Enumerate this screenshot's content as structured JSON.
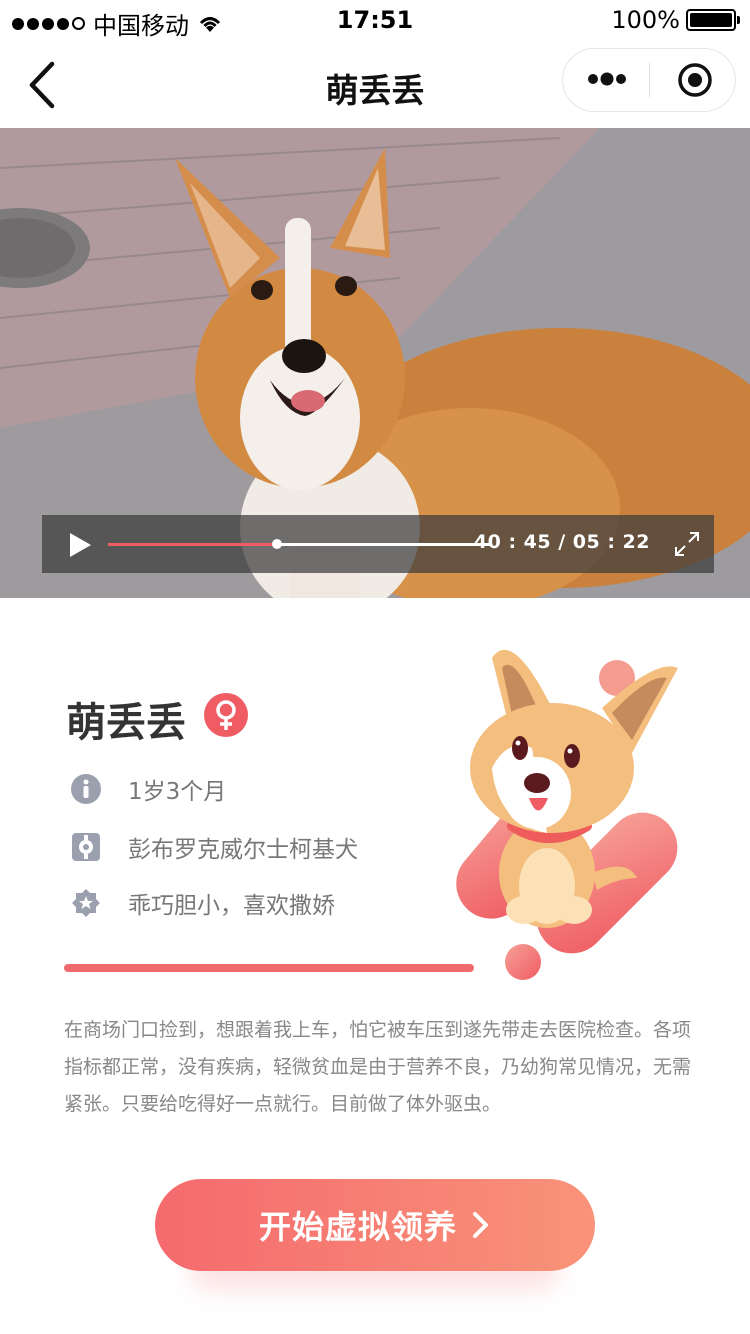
{
  "status_bar": {
    "carrier": "中国移动",
    "time": "17:51",
    "battery": "100%",
    "battery_level": 1.0
  },
  "navbar": {
    "title": "萌丢丢"
  },
  "video": {
    "time_display": "40 : 45 / 05 : 22",
    "progress": 0.44
  },
  "pet": {
    "name": "萌丢丢",
    "gender_symbol": "♀",
    "age": "1岁3个月",
    "breed": "彭布罗克威尔士柯基犬",
    "personality": "乖巧胆小，喜欢撒娇",
    "description": "在商场门口捡到，想跟着我上车，怕它被车压到遂先带走去医院检查。各项指标都正常，没有疾病，轻微贫血是由于营养不良，乃幼狗常见情况，无需紧张。只要给吃得好一点就行。目前做了体外驱虫。"
  },
  "cta": {
    "label": "开始虚拟领养"
  },
  "colors": {
    "accent": "#ef5c63",
    "button_start": "#f56a6e",
    "button_end": "#f99379",
    "text_dark": "#333333",
    "text_muted": "#888888"
  },
  "icons": {
    "back": "back-chevron-icon",
    "more": "more-dots-icon",
    "close_target": "target-icon",
    "play": "play-icon",
    "fullscreen": "fullscreen-icon",
    "age": "info-icon",
    "breed": "breed-icon",
    "personality": "badge-icon",
    "gender": "female-icon"
  }
}
